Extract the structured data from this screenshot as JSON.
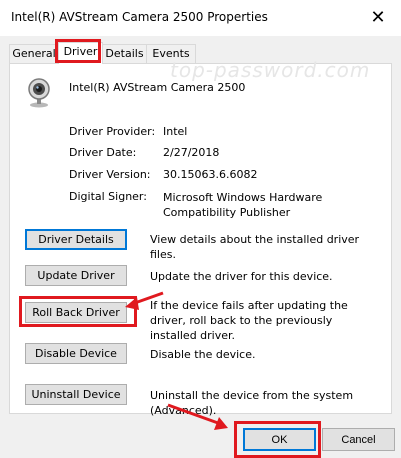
{
  "window": {
    "title": "Intel(R) AVStream Camera 2500 Properties",
    "close_glyph": "✕"
  },
  "tabs": [
    {
      "label": "General"
    },
    {
      "label": "Driver"
    },
    {
      "label": "Details"
    },
    {
      "label": "Events"
    }
  ],
  "watermark": "top-password.com",
  "device": {
    "name": "Intel(R) AVStream Camera 2500",
    "icon": "webcam-icon"
  },
  "properties": [
    {
      "label": "Driver Provider:",
      "value": "Intel"
    },
    {
      "label": "Driver Date:",
      "value": "2/27/2018"
    },
    {
      "label": "Driver Version:",
      "value": "30.15063.6.6082"
    },
    {
      "label": "Digital Signer:",
      "value": "Microsoft Windows Hardware Compatibility Publisher"
    }
  ],
  "actions": [
    {
      "button": "Driver Details",
      "description": "View details about the installed driver files."
    },
    {
      "button": "Update Driver",
      "description": "Update the driver for this device."
    },
    {
      "button": "Roll Back Driver",
      "description": "If the device fails after updating the driver, roll back to the previously installed driver."
    },
    {
      "button": "Disable Device",
      "description": "Disable the device."
    },
    {
      "button": "Uninstall Device",
      "description": "Uninstall the device from the system (Advanced)."
    }
  ],
  "footer": {
    "ok": "OK",
    "cancel": "Cancel"
  },
  "colors": {
    "annotation_red": "#e0191f",
    "focus_blue": "#0078d7",
    "dialog_bg": "#f0f0f0"
  }
}
